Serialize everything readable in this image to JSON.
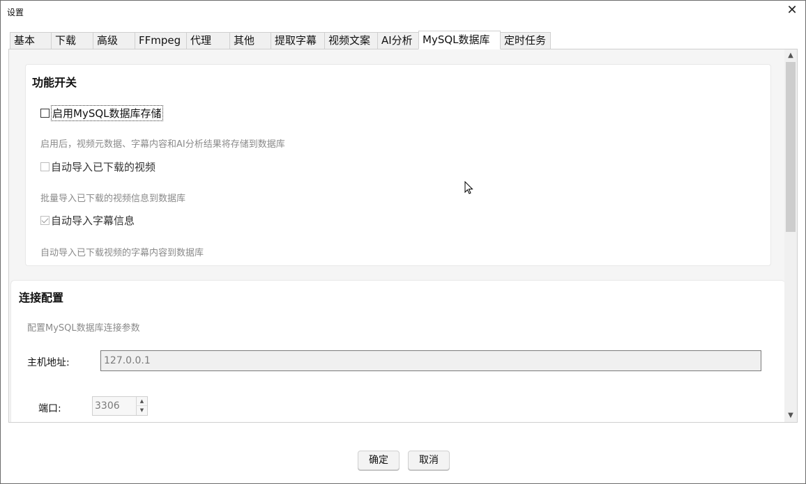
{
  "window": {
    "title": "设置"
  },
  "tabs": [
    {
      "label": "基本",
      "active": false
    },
    {
      "label": "下载",
      "active": false
    },
    {
      "label": "高级",
      "active": false
    },
    {
      "label": "FFmpeg",
      "active": false
    },
    {
      "label": "代理",
      "active": false
    },
    {
      "label": "其他",
      "active": false
    },
    {
      "label": "提取字幕",
      "active": false
    },
    {
      "label": "视频文案",
      "active": false
    },
    {
      "label": "AI分析",
      "active": false
    },
    {
      "label": "MySQL数据库",
      "active": true
    },
    {
      "label": "定时任务",
      "active": false
    }
  ],
  "feature_group": {
    "title": "功能开关",
    "enable_mysql": {
      "label": "启用MySQL数据库存储",
      "checked": false
    },
    "enable_hint": "启用后，视频元数据、字幕内容和AI分析结果将存储到数据库",
    "auto_import_videos": {
      "label": "自动导入已下载的视频",
      "checked": false
    },
    "auto_import_videos_hint": "批量导入已下载的视频信息到数据库",
    "auto_import_subtitles": {
      "label": "自动导入字幕信息",
      "checked": true
    },
    "auto_import_subtitles_hint": "自动导入已下载视频的字幕内容到数据库"
  },
  "connection_group": {
    "title": "连接配置",
    "hint": "配置MySQL数据库连接参数",
    "host_label": "主机地址:",
    "host_value": "127.0.0.1",
    "port_label": "端口:",
    "port_value": "3306"
  },
  "buttons": {
    "ok": "确定",
    "cancel": "取消"
  }
}
